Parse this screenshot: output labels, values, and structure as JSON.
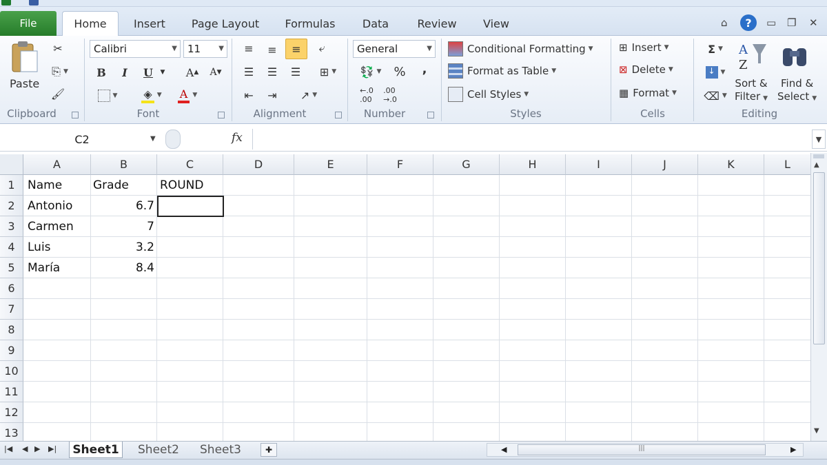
{
  "ribbon_tabs": {
    "file": "File",
    "home": "Home",
    "insert": "Insert",
    "page_layout": "Page Layout",
    "formulas": "Formulas",
    "data": "Data",
    "review": "Review",
    "view": "View"
  },
  "clipboard": {
    "paste": "Paste",
    "label": "Clipboard"
  },
  "font": {
    "name": "Calibri",
    "size": "11",
    "bold": "B",
    "italic": "I",
    "underline": "U",
    "label": "Font"
  },
  "alignment": {
    "label": "Alignment"
  },
  "number": {
    "format": "General",
    "percent": "%",
    "comma": ",",
    "label": "Number"
  },
  "styles": {
    "conditional": "Conditional Formatting",
    "table": "Format as Table",
    "cell_styles": "Cell Styles",
    "label": "Styles"
  },
  "cells": {
    "insert": "Insert",
    "delete": "Delete",
    "format": "Format",
    "label": "Cells"
  },
  "editing": {
    "sum": "Σ",
    "sort1": "Sort &",
    "sort2": "Filter",
    "find1": "Find &",
    "find2": "Select",
    "label": "Editing"
  },
  "formula_bar": {
    "name_box": "C2",
    "fx": "fx",
    "value": ""
  },
  "columns": [
    "A",
    "B",
    "C",
    "D",
    "E",
    "F",
    "G",
    "H",
    "I",
    "J",
    "K",
    "L"
  ],
  "rows": [
    "1",
    "2",
    "3",
    "4",
    "5",
    "6",
    "7",
    "8",
    "9",
    "10",
    "11",
    "12",
    "13"
  ],
  "cells_data": {
    "A1": "Name",
    "B1": "Grade",
    "C1": "ROUND",
    "A2": "Antonio",
    "B2": "6.7",
    "A3": "Carmen",
    "B3": "7",
    "A4": "Luis",
    "B4": "3.2",
    "A5": "María",
    "B5": "8.4"
  },
  "sheets": [
    "Sheet1",
    "Sheet2",
    "Sheet3"
  ],
  "active_sheet": "Sheet1",
  "colors": {
    "file_tab": "#2e8b34",
    "selected_button": "#fbd26a"
  }
}
